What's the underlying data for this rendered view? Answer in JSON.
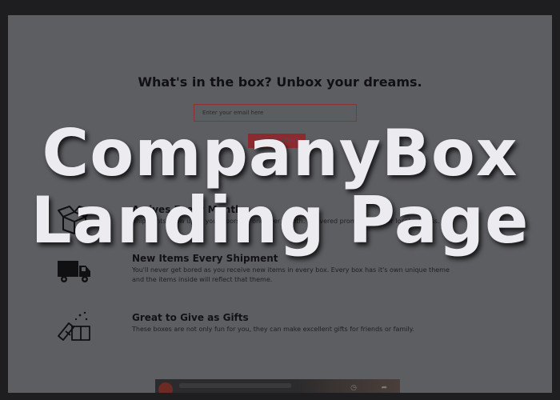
{
  "page": {
    "headline": "What's in the box? Unbox your dreams.",
    "email_placeholder": "Enter your email here",
    "cta_label": "Get Started"
  },
  "features": [
    {
      "title": "Arrives Every Month",
      "description": "Shipments show up to your doorstep once per month. Delivered promptly to your local address.",
      "icon": "open-box-icon"
    },
    {
      "title": "New Items Every Shipment",
      "description": "You'll never get bored as you receive new items in every box. Every box has it's own unique theme and the items inside will reflect that theme.",
      "icon": "delivery-truck-icon"
    },
    {
      "title": "Great to Give as Gifts",
      "description": "These boxes are not only fun for you, they can make excellent gifts for friends or family.",
      "icon": "gift-icon"
    }
  ],
  "overlay": {
    "line1": "CompanyBox",
    "line2": "Landing Page"
  },
  "colors": {
    "backdrop": "#5d5e62",
    "accent": "#8d2a2f",
    "overlay_text": "#ecebf0"
  }
}
